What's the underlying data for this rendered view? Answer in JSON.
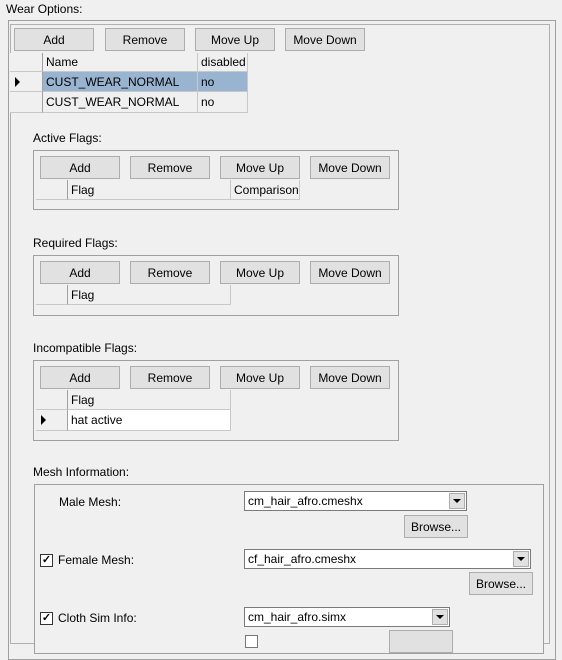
{
  "wear_options": {
    "label": "Wear Options:",
    "buttons": {
      "add": "Add",
      "remove": "Remove",
      "move_up": "Move Up",
      "move_down": "Move Down"
    },
    "columns": [
      "Name",
      "disabled"
    ],
    "rows": [
      {
        "name": "CUST_WEAR_NORMAL",
        "disabled": "no",
        "selected": true
      },
      {
        "name": "CUST_WEAR_NORMAL",
        "disabled": "no",
        "selected": false
      }
    ]
  },
  "active_flags": {
    "label": "Active Flags:",
    "columns": [
      "Flag",
      "Comparison"
    ]
  },
  "required_flags": {
    "label": "Required Flags:",
    "columns": [
      "Flag"
    ]
  },
  "incompatible_flags": {
    "label": "Incompatible Flags:",
    "columns": [
      "Flag"
    ],
    "rows": [
      "hat active"
    ]
  },
  "mesh": {
    "label": "Mesh Information:",
    "male": {
      "label": "Male Mesh:",
      "value": "cm_hair_afro.cmeshx",
      "browse": "Browse..."
    },
    "female": {
      "label": "Female Mesh:",
      "checked": true,
      "value": "cf_hair_afro.cmeshx",
      "browse": "Browse..."
    },
    "cloth": {
      "label": "Cloth Sim Info:",
      "checked": true,
      "value": "cm_hair_afro.simx"
    }
  },
  "colors": {
    "selection": "#99b4d1",
    "background": "#f0f0f0"
  }
}
